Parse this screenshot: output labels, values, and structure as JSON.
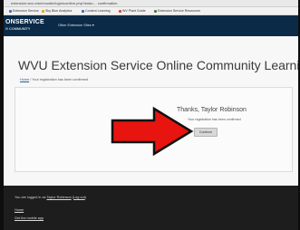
{
  "browser": {
    "url": "extension.wvu.edu/moodle/login/confirm.php?data=... confirmation",
    "bookmarks": [
      "Extension Service",
      "Sky Blue Analytics",
      "Content Learning",
      "WV Plant Guide",
      "Extension Service Resources"
    ],
    "bookmark_colors": [
      "#3f6fb3",
      "#e0a71b",
      "#3f6fb3",
      "#d44b2c",
      "#4c7a3a"
    ]
  },
  "header": {
    "brand_line1": "ONSERVICE",
    "brand_line2": "G COMMUNITY",
    "sites_menu": "Other Extension Sites ▾"
  },
  "page": {
    "title": "WVU Extension Service Online Community Learning System",
    "breadcrumb_home": "Home",
    "breadcrumb_sep": " / ",
    "breadcrumb_current": "Your registration has been confirmed"
  },
  "confirmation": {
    "thanks": "Thanks, Taylor Robinson",
    "message": "Your registration has been confirmed",
    "continue_label": "Continue"
  },
  "annotation": {
    "arrow_color": "#e8140f",
    "arrow_outline": "#111111"
  },
  "footer": {
    "logged_in_prefix": "You are logged in as ",
    "user_link": "Taylor Robinson",
    "logout_link": "Log out",
    "home_link": "Home",
    "mobile_app_link": "Get the mobile app"
  }
}
